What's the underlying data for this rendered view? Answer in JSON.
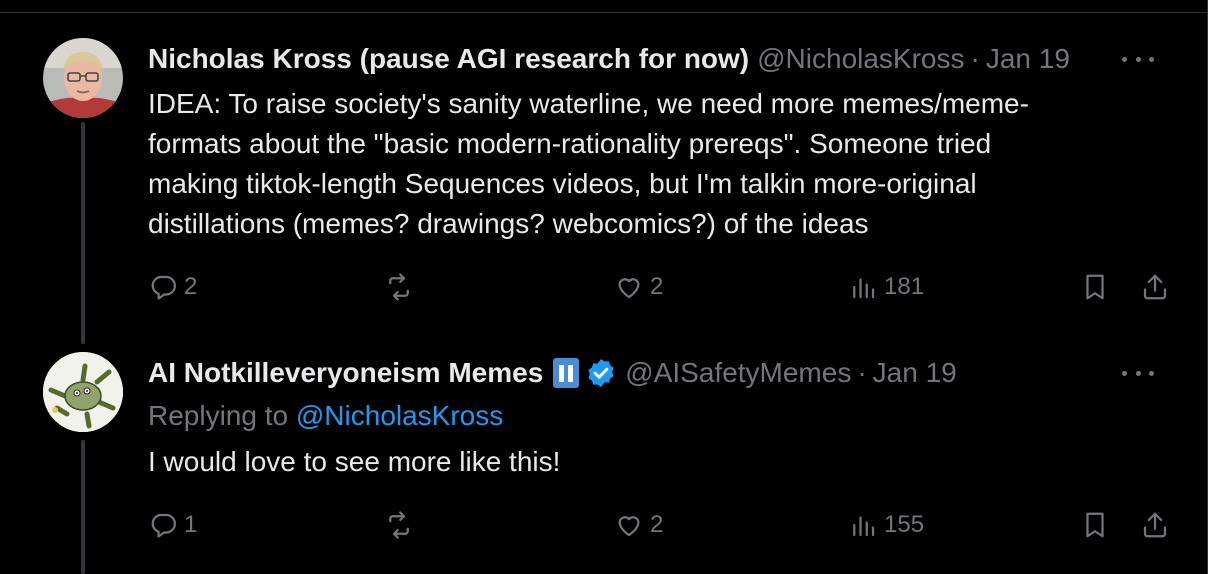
{
  "tweets": [
    {
      "name": "Nicholas Kross (pause AGI research for now)",
      "handle": "@NicholasKross",
      "separator": "·",
      "time": "Jan 19",
      "text_lines": [
        "IDEA: To raise society's sanity waterline, we need more memes/meme-",
        "formats about the \"basic modern-rationality prereqs\". Someone tried",
        "making tiktok-length Sequences videos, but I'm talkin more-original",
        "distillations (memes? drawings? webcomics?) of the ideas"
      ],
      "replies": "2",
      "retweets": "",
      "likes": "2",
      "views": "181"
    },
    {
      "name": "AI Notkilleveryoneism Memes",
      "handle": "@AISafetyMemes",
      "separator": "·",
      "time": "Jan 19",
      "replying_prefix": "Replying to",
      "replying_handle": "@NicholasKross",
      "text": "I would love to see more like this!",
      "replies": "1",
      "retweets": "",
      "likes": "2",
      "views": "155"
    }
  ],
  "icons": {
    "reply": "reply-icon",
    "retweet": "retweet-icon",
    "like": "heart-icon",
    "views": "views-icon",
    "bookmark": "bookmark-icon",
    "share": "share-icon",
    "more": "more-icon",
    "verified": "verified-badge-icon",
    "pause": "pause-icon"
  },
  "colors": {
    "background": "#000000",
    "text": "#e7e9ea",
    "muted": "#71767b",
    "link": "#1d9bf0",
    "thread_line": "#333639",
    "pause_badge": "#4c8cd6"
  }
}
